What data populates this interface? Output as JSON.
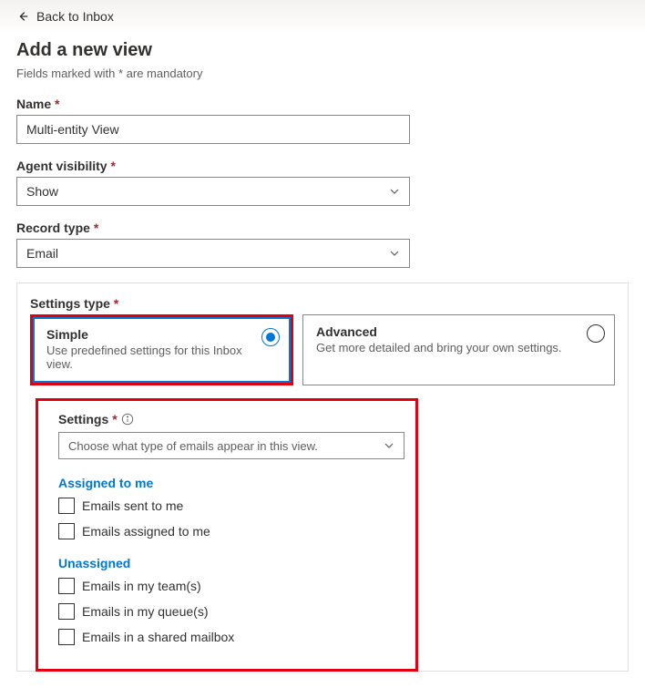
{
  "header": {
    "back_label": "Back to Inbox",
    "title": "Add a new view",
    "mandatory_note": "Fields marked with * are mandatory"
  },
  "fields": {
    "name": {
      "label": "Name",
      "value": "Multi-entity View"
    },
    "agent_visibility": {
      "label": "Agent visibility",
      "value": "Show"
    },
    "record_type": {
      "label": "Record type",
      "value": "Email"
    },
    "settings_type": {
      "label": "Settings type",
      "simple": {
        "title": "Simple",
        "desc": "Use predefined settings for this Inbox view."
      },
      "advanced": {
        "title": "Advanced",
        "desc": "Get more detailed and bring your own settings."
      }
    },
    "settings": {
      "label": "Settings",
      "placeholder": "Choose what type of emails appear in this view.",
      "groups": [
        {
          "title": "Assigned to me",
          "options": [
            "Emails sent to me",
            "Emails assigned to me"
          ]
        },
        {
          "title": "Unassigned",
          "options": [
            "Emails in my team(s)",
            "Emails in my queue(s)",
            "Emails in a shared mailbox"
          ]
        }
      ]
    }
  }
}
